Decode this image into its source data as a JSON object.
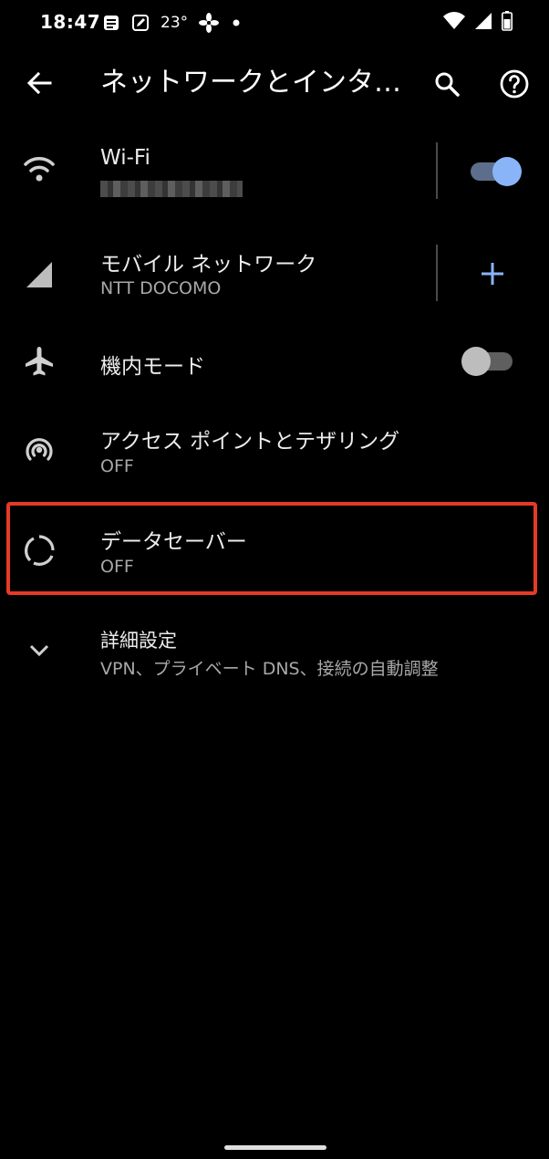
{
  "statusbar": {
    "time": "18:47",
    "temperature": "23°"
  },
  "appbar": {
    "title": "ネットワークとインタ…",
    "back_icon": "arrow-left-icon",
    "search_icon": "search-icon",
    "help_icon": "help-icon"
  },
  "rows": {
    "wifi": {
      "title": "Wi-Fi",
      "toggle_on": true
    },
    "mobile": {
      "title": "モバイル ネットワーク",
      "subtitle": "NTT DOCOMO"
    },
    "airplane": {
      "title": "機内モード",
      "toggle_on": false
    },
    "hotspot": {
      "title": "アクセス ポイントとテザリング",
      "subtitle": "OFF"
    },
    "datasaver": {
      "title": "データセーバー",
      "subtitle": "OFF"
    },
    "advanced": {
      "title": "詳細設定",
      "subtitle": "VPN、プライベート DNS、接続の自動調整"
    }
  },
  "colors": {
    "accent": "#8ab4f8",
    "toggle_track_on": "#5c6e8c",
    "toggle_off_thumb": "#bdbdbd",
    "toggle_off_track": "#5f5f5f",
    "highlight": "#e53a27"
  }
}
